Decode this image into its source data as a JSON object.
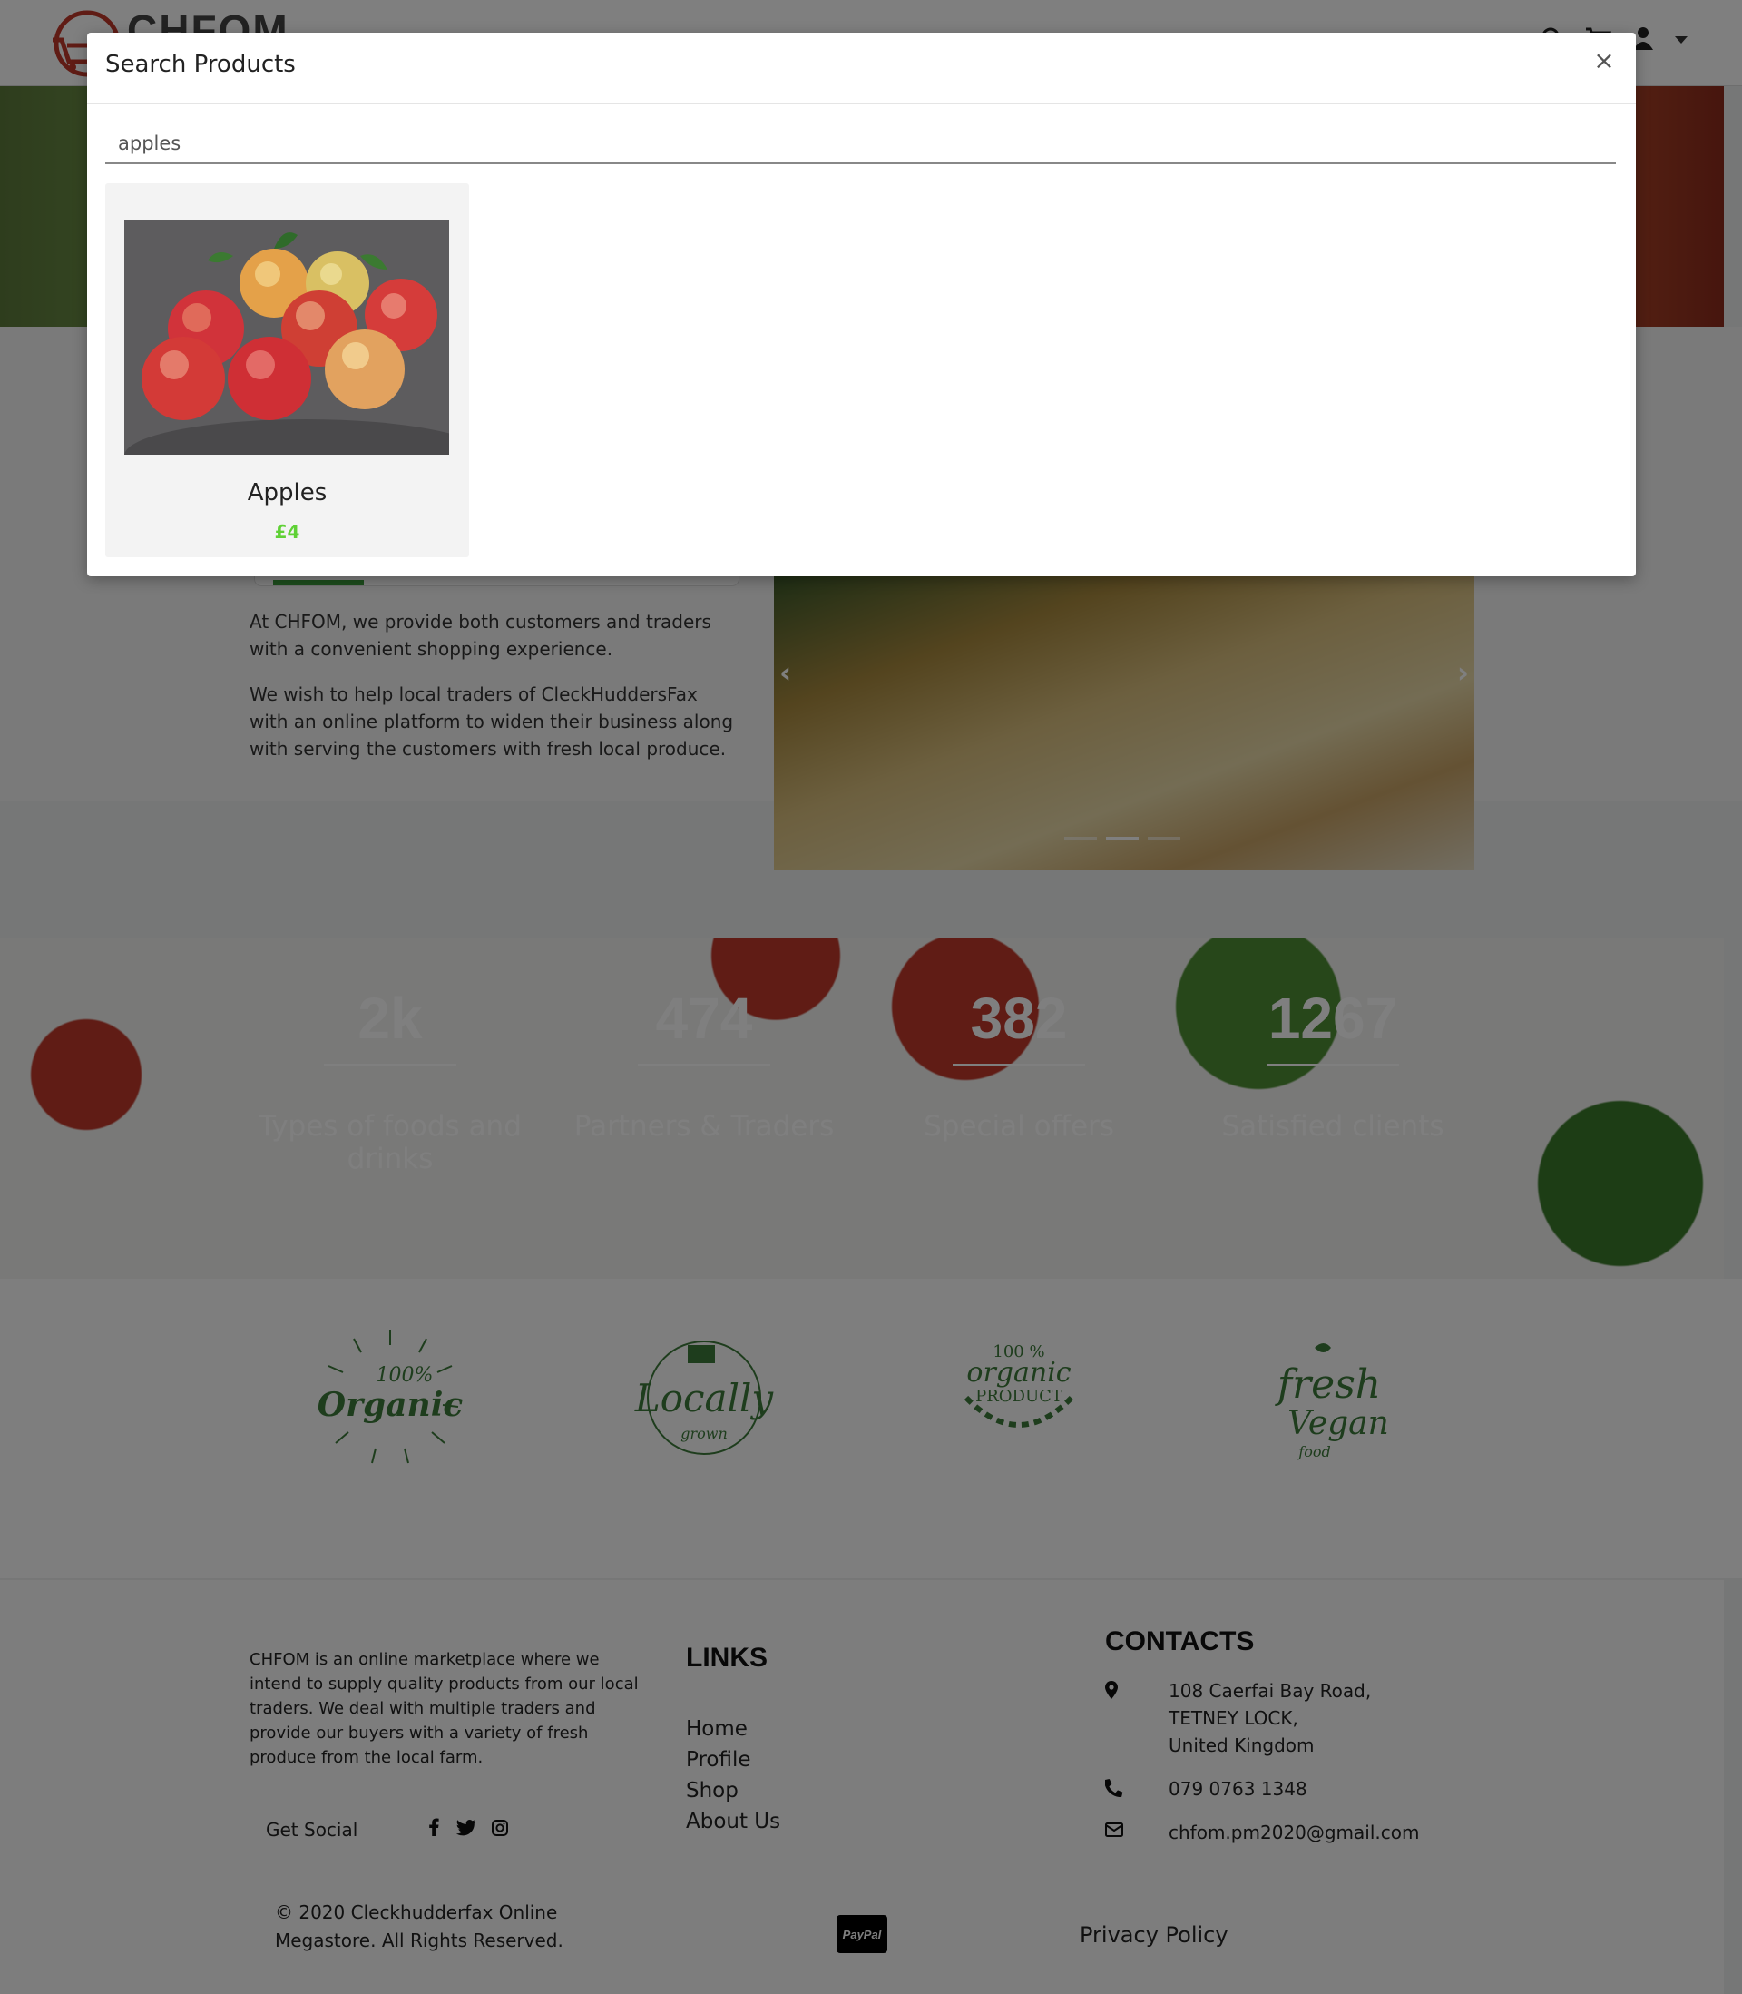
{
  "brand": {
    "name": "CHFOM"
  },
  "modal": {
    "title": "Search Products",
    "close_label": "×",
    "search_value": "apples",
    "results": [
      {
        "name": "Apples",
        "price": "£4",
        "image_icon": "apples-photo"
      }
    ]
  },
  "about": {
    "paragraphs": [
      "At CHFOM, we provide both customers and traders with a convenient shopping experience.",
      "We wish to help local traders of CleckHuddersFax with an online platform to widen their business along with serving the customers with fresh local produce."
    ]
  },
  "stats": [
    {
      "number": "2k",
      "label": "Types of foods and drinks"
    },
    {
      "number": "474",
      "label": "Partners & Traders"
    },
    {
      "number": "382",
      "label": "Special offers"
    },
    {
      "number": "1267",
      "label": "Satisfied clients"
    }
  ],
  "badges": [
    {
      "line1": "100%",
      "line2": "Organic"
    },
    {
      "line1": "Locally",
      "line2": "grown"
    },
    {
      "line1": "100 %",
      "line2": "organic",
      "line3": "PRODUCT"
    },
    {
      "line1": "fresh",
      "line2": "Vegan",
      "line3": "food"
    }
  ],
  "footer": {
    "about_text": "CHFOM is an online marketplace where we intend to supply quality products from our local traders. We deal with multiple traders and provide our buyers with a variety of fresh produce from the local farm.",
    "get_social": "Get Social",
    "links_title": "LINKS",
    "links": [
      "Home",
      "Profile",
      "Shop",
      "About Us"
    ],
    "contacts_title": "CONTACTS",
    "address": [
      "108 Caerfai Bay Road,",
      "TETNEY LOCK,",
      "United Kingdom"
    ],
    "phone": "079 0763 1348",
    "email": "chfom.pm2020@gmail.com",
    "copyright": "© 2020 Cleckhudderfax Online Megastore. All Rights Reserved.",
    "paypal_label": "PayPal",
    "privacy": "Privacy Policy"
  },
  "colors": {
    "price_green": "#5fd135",
    "backdrop": "rgba(0,0,0,0.5)",
    "brand_red": "#c0392b"
  }
}
